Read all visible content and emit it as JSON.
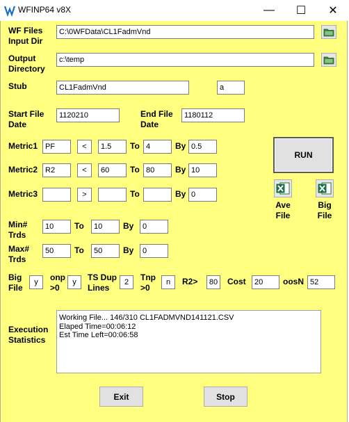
{
  "window": {
    "title": "WFINP64 v8X",
    "minimize": "—",
    "maximize": "☐",
    "close": "✕"
  },
  "paths": {
    "wf_label_1": "WF Files",
    "wf_label_2": "Input Dir",
    "wf_value": "C:\\0WFData\\CL1FadmVnd",
    "out_label_1": "Output",
    "out_label_2": "Directory",
    "out_value": "c:\\temp",
    "stub_label": "Stub",
    "stub_value": "CL1FadmVnd",
    "stub_suffix": "a"
  },
  "dates": {
    "start_label_1": "Start File",
    "start_label_2": "Date",
    "start_value": "1120210",
    "end_label_1": "End File",
    "end_label_2": "Date",
    "end_value": "1180112"
  },
  "metrics": [
    {
      "label": "Metric1",
      "name": "PF",
      "op": "<",
      "from": "1.5",
      "to_label": "To",
      "to": "4",
      "by_label": "By",
      "by": "0.5"
    },
    {
      "label": "Metric2",
      "name": "R2",
      "op": "<",
      "from": "60",
      "to_label": "To",
      "to": "80",
      "by_label": "By",
      "by": "10"
    },
    {
      "label": "Metric3",
      "name": "",
      "op": ">",
      "from": "",
      "to_label": "To",
      "to": "",
      "by_label": "By",
      "by": "0"
    }
  ],
  "trds": {
    "min_label_1": "Min#",
    "min_label_2": "Trds",
    "min_from": "10",
    "min_to_label": "To",
    "min_to": "10",
    "min_by_label": "By",
    "min_by": "0",
    "max_label_1": "Max#",
    "max_label_2": "Trds",
    "max_from": "50",
    "max_to_label": "To",
    "max_to": "50",
    "max_by_label": "By",
    "max_by": "0"
  },
  "options": {
    "big_file_label_1": "Big",
    "big_file_label_2": "File",
    "big_file_value": "y",
    "onp_label_1": "onp",
    "onp_label_2": ">0",
    "onp_value": "y",
    "ts_dup_label_1": "TS Dup",
    "ts_dup_label_2": "Lines",
    "ts_dup_value": "2",
    "tnp_label_1": "Tnp",
    "tnp_label_2": ">0",
    "tnp_value": "n",
    "r2_label": "R2>",
    "r2_value": "80",
    "cost_label": "Cost",
    "cost_value": "20",
    "oosn_label": "oosN",
    "oosn_value": "52"
  },
  "actions": {
    "run": "RUN",
    "ave_file_1": "Ave",
    "ave_file_2": "File",
    "big_file_1": "Big",
    "big_file_2": "File",
    "exit": "Exit",
    "stop": "Stop"
  },
  "execution": {
    "label_1": "Execution",
    "label_2": "Statistics",
    "lines": [
      "Working File... 146/310 CL1FADMVND141121.CSV",
      "Elaped Time=00:06:12",
      "Est Time Left=00:06:58"
    ]
  },
  "colors": {
    "background": "#ffff80",
    "excel_green": "#1e7145",
    "folder_green": "#3c8c3c"
  }
}
